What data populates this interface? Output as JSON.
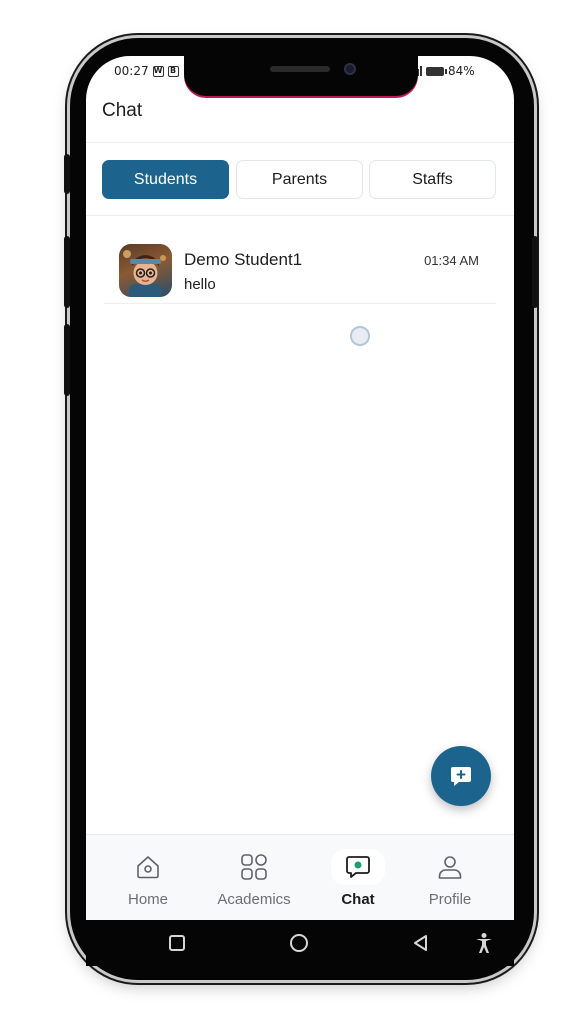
{
  "status_bar": {
    "time": "00:27",
    "notification_icons": [
      "W",
      "B"
    ],
    "battery": "84%"
  },
  "header": {
    "title": "Chat"
  },
  "tabs": [
    {
      "label": "Students",
      "active": true
    },
    {
      "label": "Parents",
      "active": false
    },
    {
      "label": "Staffs",
      "active": false
    }
  ],
  "chats": [
    {
      "name": "Demo Student1",
      "message": "hello",
      "time": "01:34 AM"
    }
  ],
  "fab": {
    "icon": "new-chat-icon"
  },
  "bottom_nav": [
    {
      "label": "Home",
      "icon": "home-icon",
      "active": false
    },
    {
      "label": "Academics",
      "icon": "grid-icon",
      "active": false
    },
    {
      "label": "Chat",
      "icon": "chat-icon",
      "active": true
    },
    {
      "label": "Profile",
      "icon": "profile-icon",
      "active": false
    }
  ],
  "colors": {
    "accent": "#1c648e",
    "active_dot": "#1aa06d"
  }
}
